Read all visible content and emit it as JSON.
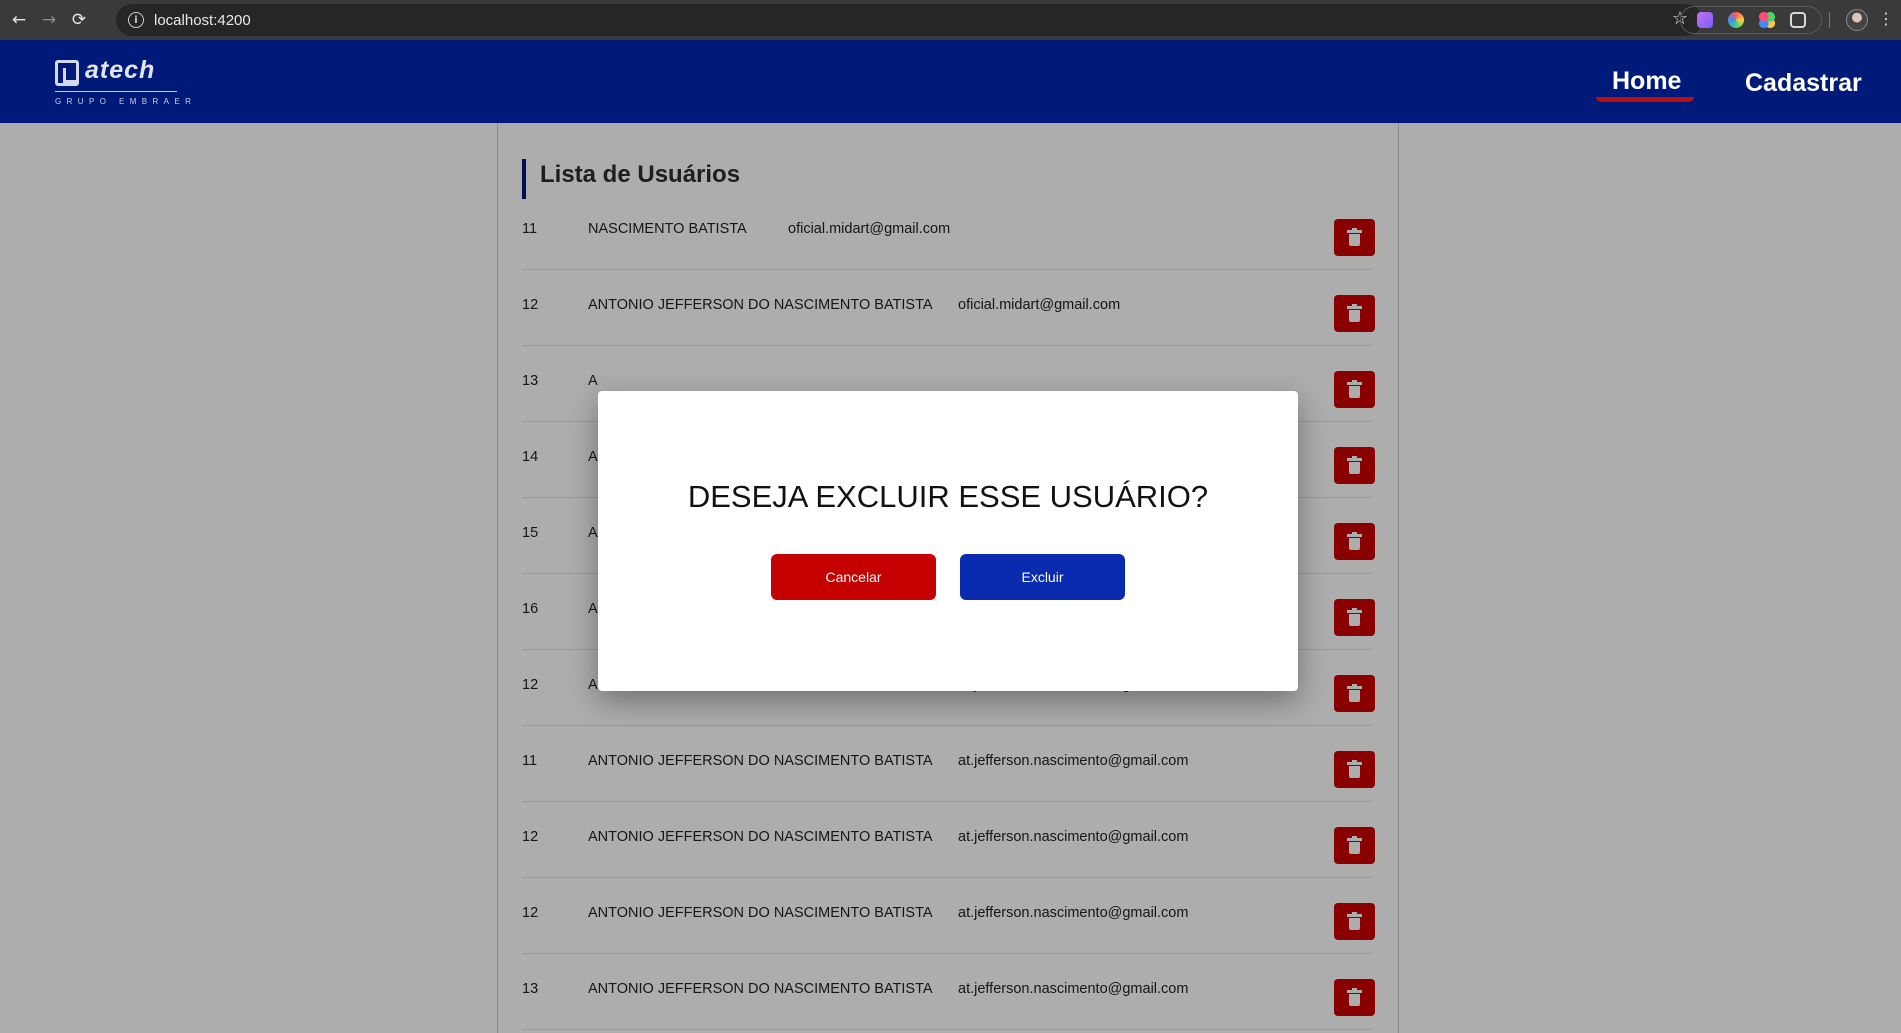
{
  "browser": {
    "url": "localhost:4200",
    "back_icon": "←",
    "forward_icon": "→",
    "reload_icon": "⟳",
    "info_icon": "i",
    "star_icon": "☆",
    "menu_icon": "⋮"
  },
  "header": {
    "logo_text": "atech",
    "logo_sub": "GRUPO EMBRAER",
    "nav": {
      "home": "Home",
      "cadastrar": "Cadastrar"
    },
    "colors": {
      "background": "#001a7a",
      "active_underline": "#b80e16"
    }
  },
  "list": {
    "title": "Lista de Usuários",
    "rows": [
      {
        "id": "11",
        "name": "NASCIMENTO BATISTA",
        "email": "oficial.midart@gmail.com"
      },
      {
        "id": "12",
        "name": "ANTONIO JEFFERSON DO NASCIMENTO BATISTA",
        "email": "oficial.midart@gmail.com"
      },
      {
        "id": "13",
        "name": "A",
        "email": ""
      },
      {
        "id": "14",
        "name": "A",
        "email": ""
      },
      {
        "id": "15",
        "name": "A",
        "email": ""
      },
      {
        "id": "16",
        "name": "A",
        "email": ""
      },
      {
        "id": "12",
        "name": "ANTONIO JEFFERSON DO NASCIMENTO BATISTA",
        "email": "at.jefferson.nascimento@gmail.com"
      },
      {
        "id": "11",
        "name": "ANTONIO JEFFERSON DO NASCIMENTO BATISTA",
        "email": "at.jefferson.nascimento@gmail.com"
      },
      {
        "id": "12",
        "name": "ANTONIO JEFFERSON DO NASCIMENTO BATISTA",
        "email": "at.jefferson.nascimento@gmail.com"
      },
      {
        "id": "12",
        "name": "ANTONIO JEFFERSON DO NASCIMENTO BATISTA",
        "email": "at.jefferson.nascimento@gmail.com"
      },
      {
        "id": "13",
        "name": "ANTONIO JEFFERSON DO NASCIMENTO BATISTA",
        "email": "at.jefferson.nascimento@gmail.com"
      }
    ],
    "delete_icon": "trash-icon",
    "colors": {
      "delete": "#cc0000"
    }
  },
  "modal": {
    "title": "DESEJA EXCLUIR ESSE USUÁRIO?",
    "cancel_label": "Cancelar",
    "confirm_label": "Excluir",
    "colors": {
      "cancel": "#c40000",
      "confirm": "#0a2bb0"
    }
  }
}
